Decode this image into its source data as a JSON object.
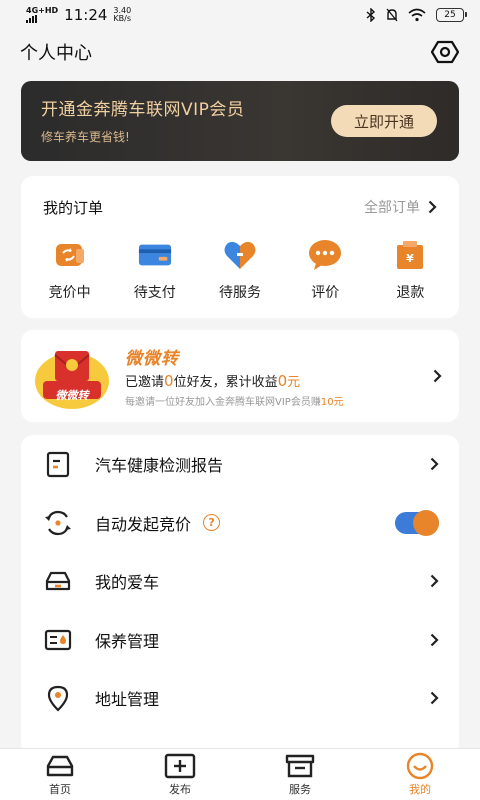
{
  "statusbar": {
    "network": "4G+HD",
    "time": "11:24",
    "speed_value": "3.40",
    "speed_unit": "KB/s",
    "battery": "25"
  },
  "header": {
    "title": "个人中心",
    "settings_icon": "hexagon-settings-icon"
  },
  "vip": {
    "title": "开通金奔腾车联网VIP会员",
    "subtitle": "修车养车更省钱!",
    "button": "立即开通"
  },
  "orders": {
    "title": "我的订单",
    "all_label": "全部订单",
    "items": [
      {
        "label": "竞价中",
        "icon": "bidding-icon"
      },
      {
        "label": "待支付",
        "icon": "card-payment-icon"
      },
      {
        "label": "待服务",
        "icon": "service-heart-icon"
      },
      {
        "label": "评价",
        "icon": "comment-bubble-icon"
      },
      {
        "label": "退款",
        "icon": "refund-bag-icon"
      }
    ]
  },
  "invite": {
    "brand": "微微转",
    "logo_text": "微微转",
    "line_prefix": "已邀请",
    "invited_count": "0",
    "line_middle": "位好友，累计收益",
    "earnings": "0",
    "earnings_unit": "元",
    "note_prefix": "每邀请一位好友加入金奔腾车联网VIP会员赚",
    "note_amount": "10元"
  },
  "menu": {
    "items": [
      {
        "label": "汽车健康检测报告",
        "icon": "report-icon"
      },
      {
        "label": "自动发起竞价",
        "icon": "auto-refresh-icon",
        "toggle_on": true
      },
      {
        "label": "我的爱车",
        "icon": "car-icon"
      },
      {
        "label": "保养管理",
        "icon": "maintenance-icon"
      },
      {
        "label": "地址管理",
        "icon": "location-pin-icon"
      }
    ]
  },
  "tabbar": {
    "items": [
      {
        "label": "首页",
        "icon": "car-home-icon",
        "active": false
      },
      {
        "label": "发布",
        "icon": "plus-square-icon",
        "active": false
      },
      {
        "label": "服务",
        "icon": "shop-icon",
        "active": false
      },
      {
        "label": "我的",
        "icon": "smile-icon",
        "active": true
      }
    ]
  },
  "colors": {
    "accent": "#e8842a",
    "vip_gold": "#f3dbb8",
    "toggle_blue": "#3d7bd9"
  }
}
